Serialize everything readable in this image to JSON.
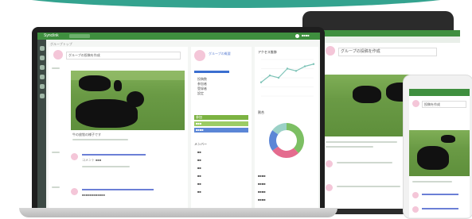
{
  "app": {
    "title": "Synclink",
    "accent": "#3f8f3f",
    "brand_teal": "#34a38f",
    "header_user": "■■■■"
  },
  "laptop": {
    "breadcrumb": "グループトップ",
    "post_placeholder": "グループの投稿を作成",
    "feed": [
      {
        "caption": "牛の放牧の様子です"
      },
      {
        "caption": "コメント ■■■"
      },
      {
        "caption": "■■■■■■■■■■■■"
      }
    ],
    "right_panel": {
      "profile_text": "グループの概要",
      "menu_items": [
        "投稿数",
        "参加者",
        "登録者",
        "設定"
      ],
      "buttons": [
        "参加",
        "■■■",
        "■■■■"
      ],
      "section_title": "メンバー",
      "members": [
        "■■",
        "■■",
        "■■",
        "■■",
        "■■",
        "■■"
      ]
    },
    "stats": {
      "chart_title": "アクセス推移",
      "donut_title": "割合",
      "list": [
        "■■■■",
        "■■■■",
        "■■■■",
        "■■■■"
      ]
    }
  },
  "tablet": {
    "post_placeholder": "グループの投稿を作成"
  },
  "phone": {
    "post_placeholder": "投稿を作成"
  },
  "chart_data": {
    "type": "line",
    "x": [
      1,
      2,
      3,
      4,
      5,
      6,
      7
    ],
    "values": [
      6,
      9,
      8,
      12,
      11,
      13,
      14
    ],
    "xlabel": "",
    "ylabel": "",
    "ylim": [
      0,
      16
    ],
    "grid": true,
    "color": "#7fc4b8"
  },
  "donut_data": {
    "type": "pie",
    "values": [
      38,
      27,
      20,
      15
    ],
    "colors": [
      "#7cbf63",
      "#e46b8e",
      "#5b86d6",
      "#9bd1c7"
    ]
  }
}
